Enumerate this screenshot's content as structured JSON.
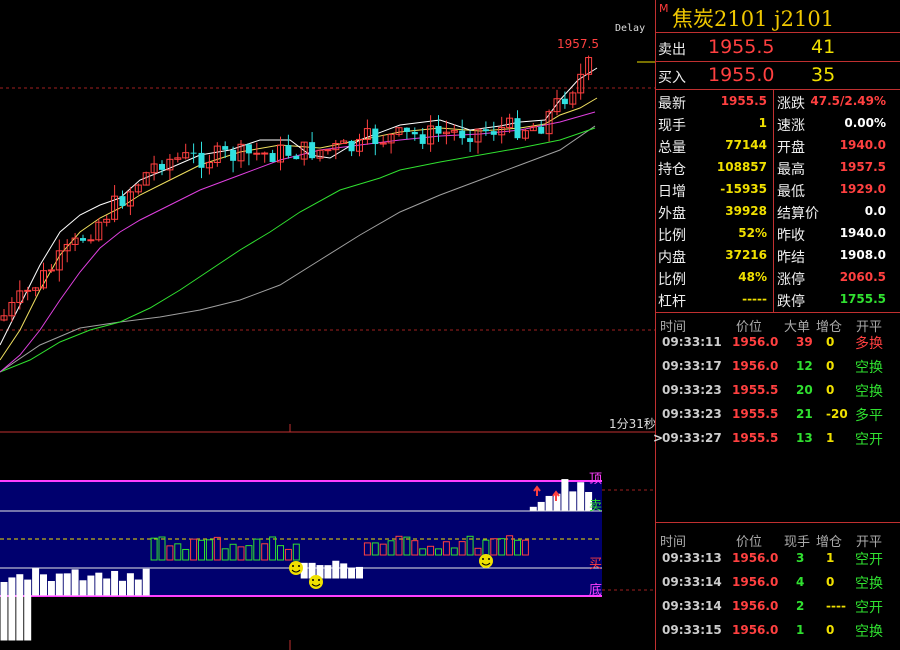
{
  "chart": {
    "delay_label": "Delay",
    "high_price_label": "1957.5",
    "period_label": "1分31秒",
    "indicator_labels": [
      "顶",
      "卖",
      "买",
      "底"
    ]
  },
  "header": {
    "flag": "M",
    "title": "焦炭2101  j2101"
  },
  "quotes": {
    "sell": {
      "label": "卖出",
      "price": "1955.5",
      "volume": "41"
    },
    "buy": {
      "label": "买入",
      "price": "1955.0",
      "volume": "35"
    }
  },
  "stats_left": [
    {
      "key": "最新",
      "value": "1955.5",
      "color": "#ff4040"
    },
    {
      "key": "现手",
      "value": "1",
      "color": "#f0e000"
    },
    {
      "key": "总量",
      "value": "77144",
      "color": "#f0e000"
    },
    {
      "key": "持仓",
      "value": "108857",
      "color": "#f0e000"
    },
    {
      "key": "日增",
      "value": "-15935",
      "color": "#f0e000"
    },
    {
      "key": "外盘",
      "value": "39928",
      "color": "#f0e000"
    },
    {
      "key": "比例",
      "value": "52%",
      "color": "#f0e000"
    },
    {
      "key": "内盘",
      "value": "37216",
      "color": "#f0e000"
    },
    {
      "key": "比例",
      "value": "48%",
      "color": "#f0e000"
    },
    {
      "key": "杠杆",
      "value": "-----",
      "color": "#f0e000"
    }
  ],
  "stats_right": [
    {
      "key": "涨跌",
      "value": "47.5/2.49%",
      "color": "#ff4040"
    },
    {
      "key": "速涨",
      "value": "0.00%",
      "color": "#ffffff"
    },
    {
      "key": "开盘",
      "value": "1940.0",
      "color": "#ff4040"
    },
    {
      "key": "最高",
      "value": "1957.5",
      "color": "#ff4040"
    },
    {
      "key": "最低",
      "value": "1929.0",
      "color": "#ff4040"
    },
    {
      "key": "结算价",
      "value": "0.0",
      "color": "#ffffff"
    },
    {
      "key": "昨收",
      "value": "1940.0",
      "color": "#ffffff"
    },
    {
      "key": "昨结",
      "value": "1908.0",
      "color": "#ffffff"
    },
    {
      "key": "涨停",
      "value": "2060.5",
      "color": "#ff4040"
    },
    {
      "key": "跌停",
      "value": "1755.5",
      "color": "#30e030"
    }
  ],
  "big_orders": {
    "headers": [
      "时间",
      "价位",
      "大单",
      "增仓",
      "开平"
    ],
    "rows": [
      {
        "time": "09:33:11",
        "price": "1956.0",
        "qty": "39",
        "qty_color": "#ff4040",
        "chg": "0",
        "chg_color": "#f0e000",
        "type": "多换",
        "type_color": "#ff4040",
        "marker": ""
      },
      {
        "time": "09:33:17",
        "price": "1956.0",
        "qty": "12",
        "qty_color": "#30e030",
        "chg": "0",
        "chg_color": "#f0e000",
        "type": "空换",
        "type_color": "#30e030",
        "marker": ""
      },
      {
        "time": "09:33:23",
        "price": "1955.5",
        "qty": "20",
        "qty_color": "#30e030",
        "chg": "0",
        "chg_color": "#f0e000",
        "type": "空换",
        "type_color": "#30e030",
        "marker": ""
      },
      {
        "time": "09:33:23",
        "price": "1955.5",
        "qty": "21",
        "qty_color": "#30e030",
        "chg": "-20",
        "chg_color": "#f0e000",
        "type": "多平",
        "type_color": "#30e030",
        "marker": ""
      },
      {
        "time": "09:33:27",
        "price": "1955.5",
        "qty": "13",
        "qty_color": "#30e030",
        "chg": "1",
        "chg_color": "#f0e000",
        "type": "空开",
        "type_color": "#30e030",
        "marker": ">"
      }
    ]
  },
  "ticks": {
    "headers": [
      "时间",
      "价位",
      "现手",
      "增仓",
      "开平"
    ],
    "rows": [
      {
        "time": "09:33:13",
        "price": "1956.0",
        "qty": "3",
        "qty_color": "#30e030",
        "chg": "1",
        "chg_color": "#f0e000",
        "type": "空开",
        "type_color": "#30e030"
      },
      {
        "time": "09:33:14",
        "price": "1956.0",
        "qty": "4",
        "qty_color": "#30e030",
        "chg": "0",
        "chg_color": "#f0e000",
        "type": "空换",
        "type_color": "#30e030"
      },
      {
        "time": "09:33:14",
        "price": "1956.0",
        "qty": "2",
        "qty_color": "#30e030",
        "chg": "----",
        "chg_color": "#f0e000",
        "type": "空开",
        "type_color": "#30e030"
      },
      {
        "time": "09:33:15",
        "price": "1956.0",
        "qty": "1",
        "qty_color": "#30e030",
        "chg": "0",
        "chg_color": "#f0e000",
        "type": "空换",
        "type_color": "#30e030"
      }
    ]
  },
  "colors": {
    "up": "#ff4040",
    "down": "#30e0e0",
    "border": "#c03030",
    "ma5": "#ffffff",
    "ma10": "#f0e060",
    "ma20": "#e040e0",
    "ma40": "#30e030",
    "ma60": "#a0a0a0",
    "band_fill": "#00006e",
    "band_edge": "#ff40ff"
  }
}
